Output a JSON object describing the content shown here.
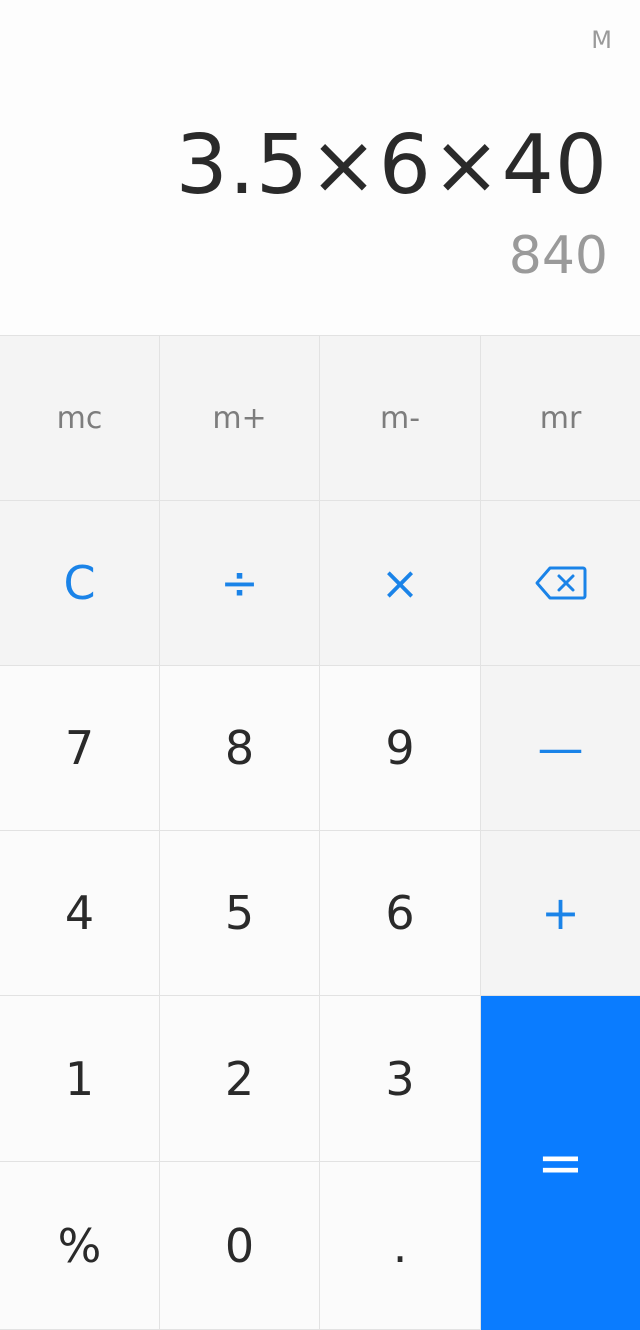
{
  "display": {
    "memory_indicator": "M",
    "expression": "3.5×6×40",
    "result": "840"
  },
  "keypad": {
    "memory": {
      "mc": "mc",
      "mplus": "m+",
      "mminus": "m-",
      "mr": "mr"
    },
    "functions": {
      "clear": "C",
      "divide": "÷",
      "multiply": "×",
      "backspace_icon": "backspace-icon"
    },
    "digits": {
      "d7": "7",
      "d8": "8",
      "d9": "9",
      "d4": "4",
      "d5": "5",
      "d6": "6",
      "d1": "1",
      "d2": "2",
      "d3": "3",
      "d0": "0"
    },
    "operators": {
      "minus": "—",
      "plus": "+",
      "equals": "=",
      "percent": "%",
      "decimal": "."
    }
  },
  "colors": {
    "accent": "#1a83e8",
    "equals_bg": "#0a7cff",
    "text": "#2a2a2a",
    "muted": "#9a9a9a"
  }
}
